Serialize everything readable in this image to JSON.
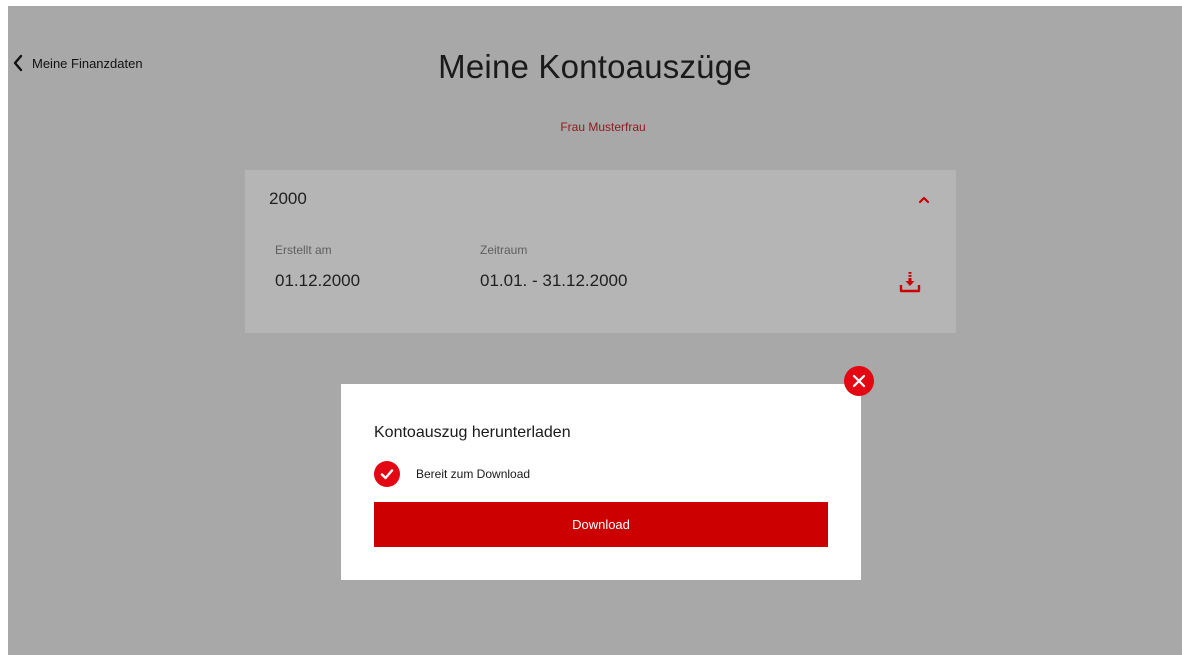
{
  "header": {
    "back_label": "Meine Finanzdaten",
    "title": "Meine Kontoauszüge",
    "customer_name": "Frau Musterfrau"
  },
  "statement_group": {
    "year": "2000",
    "created_label": "Erstellt am",
    "created_value": "01.12.2000",
    "period_label": "Zeitraum",
    "period_value": "01.01. - 31.12.2000"
  },
  "modal": {
    "title": "Kontoauszug herunterladen",
    "status": "Bereit zum Download",
    "button_label": "Download"
  },
  "colors": {
    "accent": "#e30613",
    "button": "#cc0000",
    "overlay": "#a8a8a8",
    "customer_name": "#8c1b1b"
  },
  "icons": [
    "chevron-left-icon",
    "chevron-up-icon",
    "download-icon",
    "close-icon",
    "checkmark-icon"
  ]
}
